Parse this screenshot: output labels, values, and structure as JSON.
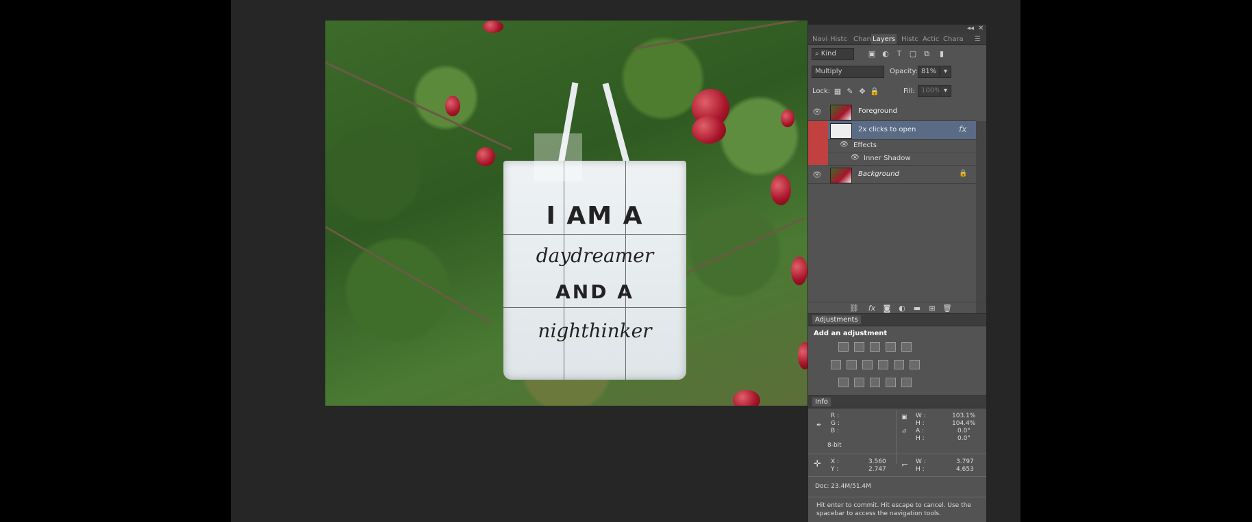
{
  "canvas": {
    "bag_text": {
      "line1": "I AM A",
      "line2": "daydreamer",
      "line3": "AND A",
      "line4": "nighthinker"
    }
  },
  "panel_controls": {
    "collapse": "◂◂",
    "close": "✕"
  },
  "tabs": [
    "Navi",
    "Histc",
    "Chan",
    "Layers",
    "Histc",
    "Actic",
    "Chara"
  ],
  "active_tab": "Layers",
  "filter": {
    "label": "Kind",
    "icon": "search-icon"
  },
  "blend": {
    "mode": "Multiply",
    "opacity_label": "Opacity:",
    "opacity_value": "81%",
    "lock_label": "Lock:",
    "fill_label": "Fill:",
    "fill_value": "100%"
  },
  "layers": [
    {
      "name": "Foreground",
      "italic": false
    },
    {
      "name": "2x clicks to open",
      "italic": false,
      "selected": true,
      "fx": "fx"
    },
    {
      "name": "Background",
      "italic": true,
      "locked": true
    }
  ],
  "effects": {
    "label": "Effects",
    "item": "Inner Shadow"
  },
  "adjustments": {
    "tab": "Adjustments",
    "title": "Add an adjustment"
  },
  "info": {
    "tab": "Info",
    "rgb": [
      "R :",
      "G :",
      "B :"
    ],
    "bitdepth": "8-bit",
    "transform": {
      "W_label": "W :",
      "W": "103.1%",
      "H_label": "H :",
      "H": "104.4%",
      "A_label": "A :",
      "A": "0.0°",
      "H2_label": "H :",
      "H2": "0.0°"
    },
    "pos": {
      "X_label": "X :",
      "X": "3.560",
      "Y_label": "Y :",
      "Y": "2.747"
    },
    "size": {
      "W_label": "W :",
      "W": "3.797",
      "H_label": "H :",
      "H": "4.653"
    },
    "doc": "Doc: 23.4M/51.4M",
    "hint": "Hit enter to commit. Hit escape to cancel. Use the spacebar to access the navigation tools."
  },
  "colors": {
    "selected_layer": "#5a6b86",
    "red_strip": "#c0413f"
  }
}
